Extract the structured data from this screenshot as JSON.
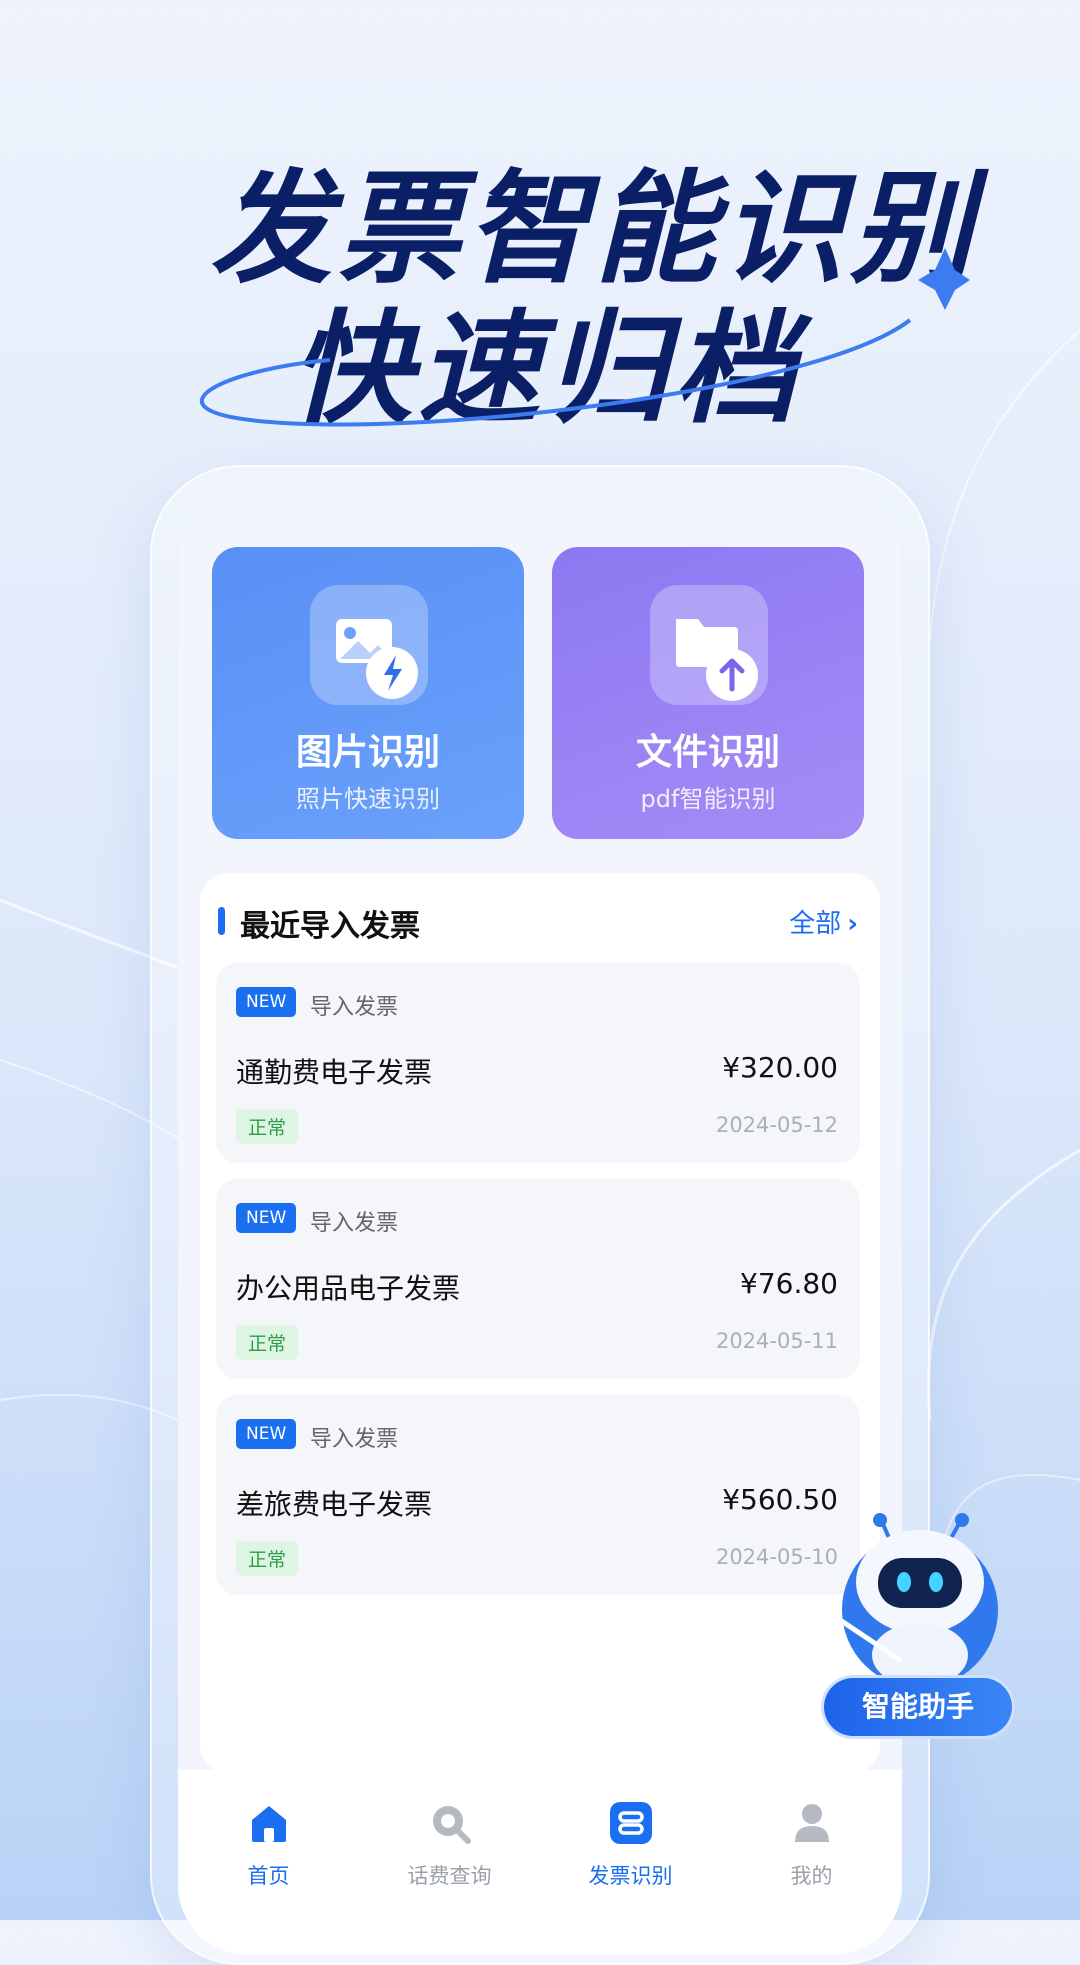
{
  "headline": {
    "line1": "发票智能识别",
    "line2": "快速归档"
  },
  "features": [
    {
      "title": "图片识别",
      "subtitle": "照片快速识别",
      "icon": "image-bolt-icon"
    },
    {
      "title": "文件识别",
      "subtitle": "pdf智能识别",
      "icon": "folder-upload-icon"
    }
  ],
  "recent": {
    "title": "最近导入发票",
    "view_all": "全部",
    "items": [
      {
        "badge": "NEW",
        "label": "导入发票",
        "name": "通勤费电子发票",
        "amount": "¥320.00",
        "status": "正常",
        "date": "2024-05-12"
      },
      {
        "badge": "NEW",
        "label": "导入发票",
        "name": "办公用品电子发票",
        "amount": "¥76.80",
        "status": "正常",
        "date": "2024-05-11"
      },
      {
        "badge": "NEW",
        "label": "导入发票",
        "name": "差旅费电子发票",
        "amount": "¥560.50",
        "status": "正常",
        "date": "2024-05-10"
      }
    ]
  },
  "nav": [
    {
      "label": "首页",
      "icon": "home-icon",
      "active": true
    },
    {
      "label": "话费查询",
      "icon": "search-icon",
      "active": false
    },
    {
      "label": "发票识别",
      "icon": "invoice-scan-icon",
      "active": true
    },
    {
      "label": "我的",
      "icon": "user-icon",
      "active": false
    }
  ],
  "assistant": {
    "label": "智能助手",
    "icon": "robot-icon"
  },
  "colors": {
    "accent": "#1a6ef0",
    "headline": "#0b1f66",
    "status_ok": "#2e9d49"
  }
}
